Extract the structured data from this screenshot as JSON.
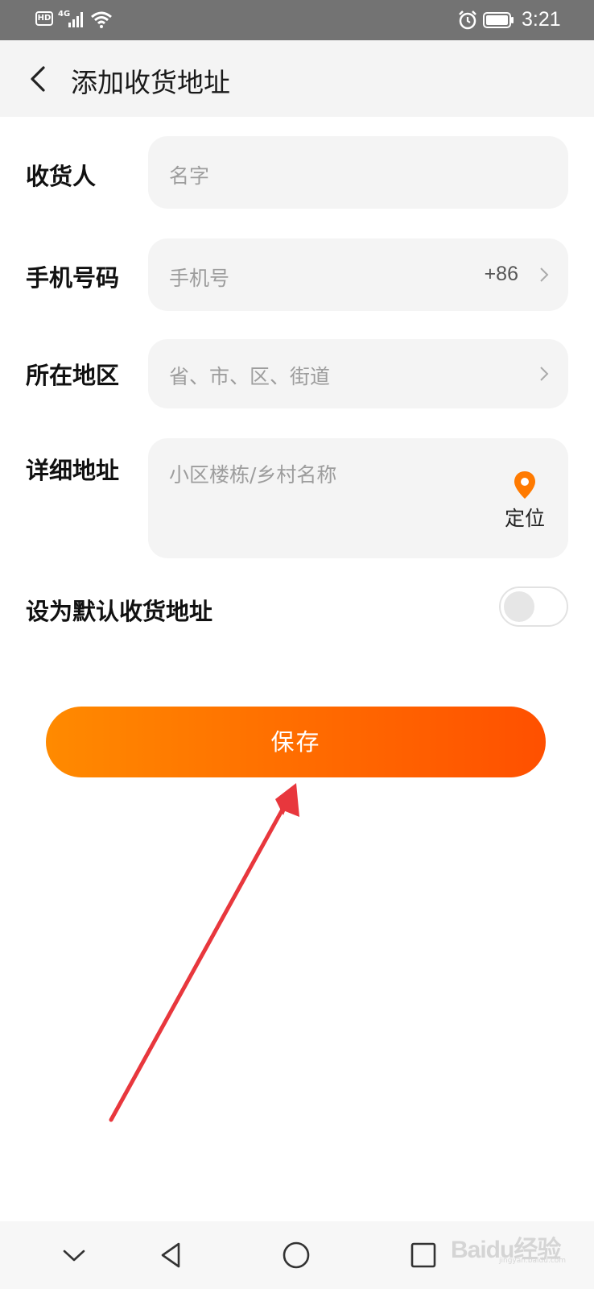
{
  "status_bar": {
    "hd": "HD",
    "network": "4G",
    "time": "3:21"
  },
  "header": {
    "title": "添加收货地址"
  },
  "form": {
    "recipient": {
      "label": "收货人",
      "placeholder": "名字"
    },
    "phone": {
      "label": "手机号码",
      "placeholder": "手机号",
      "country_code": "+86"
    },
    "region": {
      "label": "所在地区",
      "placeholder": "省、市、区、街道"
    },
    "address": {
      "label": "详细地址",
      "placeholder": "小区楼栋/乡村名称",
      "locate_label": "定位"
    },
    "default": {
      "label": "设为默认收货地址",
      "enabled": false
    }
  },
  "save_button": {
    "label": "保存"
  },
  "watermark": {
    "text": "Baidu经验",
    "sub": "jingyan.baidu.com"
  },
  "colors": {
    "accent": "#ff6a00",
    "annotation_arrow": "#e8373d",
    "placeholder": "#9d9d9d"
  },
  "icons": [
    "back-arrow-icon",
    "chevron-right-icon",
    "location-pin-icon",
    "nav-down-icon",
    "nav-back-icon",
    "nav-home-icon",
    "nav-recents-icon"
  ]
}
